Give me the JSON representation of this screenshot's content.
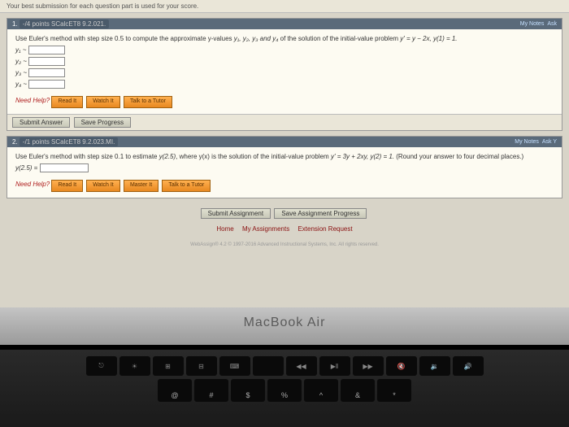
{
  "header_note": "Your best submission for each question part is used for your score.",
  "q1": {
    "num": "1.",
    "points": "-/4 points  SCalcET8 9.2.021.",
    "mynotes": "My Notes",
    "ask": "Ask",
    "prompt_a": "Use Euler's method with step size 0.5 to compute the approximate y-values ",
    "yv": "y₁, y₂, y₃ and y₄",
    "prompt_b": " of the solution of the initial-value problem ",
    "eq": "y' = y − 2x,   y(1) = 1.",
    "labels": [
      "y₁ ~",
      "y₂ ~",
      "y₃ ~",
      "y₄ ~"
    ],
    "need": "Need Help?",
    "btns": [
      "Read It",
      "Watch It",
      "Talk to a Tutor"
    ],
    "submit": "Submit Answer",
    "save": "Save Progress"
  },
  "q2": {
    "num": "2.",
    "points": "-/1 points  SCalcET8 9.2.023.MI.",
    "mynotes": "My Notes",
    "ask": "Ask Y",
    "prompt_a": "Use Euler's method with step size 0.1 to estimate ",
    "yv": "y(2.5)",
    "prompt_b": ", where y(x) is the solution of the initial-value problem ",
    "eq": "y' = 3y + 2xy, y(2) = 1.",
    "round": " (Round your answer to four decimal places.)",
    "ylabel": "y(2.5) = ",
    "need": "Need Help?",
    "btns": [
      "Read It",
      "Watch It",
      "Master It",
      "Talk to a Tutor"
    ]
  },
  "bottom": {
    "submit": "Submit Assignment",
    "save": "Save Assignment Progress",
    "home": "Home",
    "assign": "My Assignments",
    "ext": "Extension Request",
    "copy": "WebAssign® 4.2 © 1997-2016 Advanced Instructional Systems, Inc. All rights reserved."
  },
  "mac": "MacBook Air",
  "fkeys": [
    "F1",
    "F2",
    "F3",
    "F4",
    "F5",
    "F6",
    "F7",
    "F8",
    "F9",
    "F10",
    "F11",
    "F12"
  ],
  "symkeys": [
    "@",
    "#",
    "$",
    "%",
    "^",
    "&",
    "*"
  ]
}
